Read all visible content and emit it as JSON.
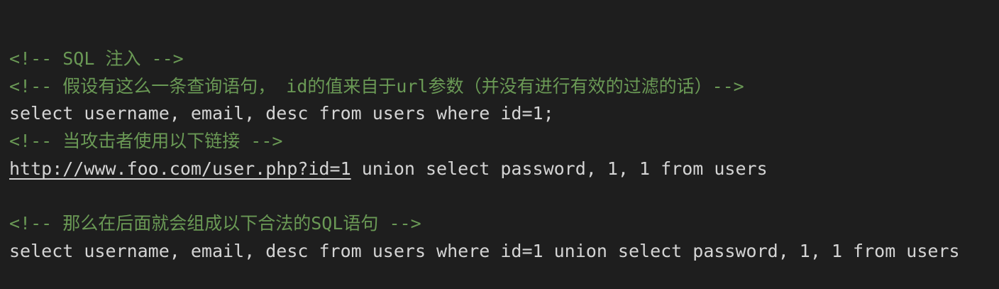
{
  "code": {
    "lines": [
      {
        "type": "comment",
        "text": "<!-- SQL 注入 -->"
      },
      {
        "type": "comment",
        "text": "<!-- 假设有这么一条查询语句， id的值来自于url参数（并没有进行有效的过滤的话）-->"
      },
      {
        "type": "code",
        "text": "select username, email, desc from users where id=1;"
      },
      {
        "type": "comment",
        "text": "<!-- 当攻击者使用以下链接 -->"
      },
      {
        "type": "code_with_link",
        "link": "http://www.foo.com/user.php?id=1",
        "rest": " union select password, 1, 1 from users"
      },
      {
        "type": "blank",
        "text": ""
      },
      {
        "type": "comment",
        "text": "<!-- 那么在后面就会组成以下合法的SQL语句 -->"
      },
      {
        "type": "code",
        "text": "select username, email, desc from users where id=1 union select password, 1, 1 from users"
      }
    ]
  },
  "colors": {
    "background": "#1e1e1e",
    "comment": "#6a9955",
    "code": "#d4d4d4"
  }
}
